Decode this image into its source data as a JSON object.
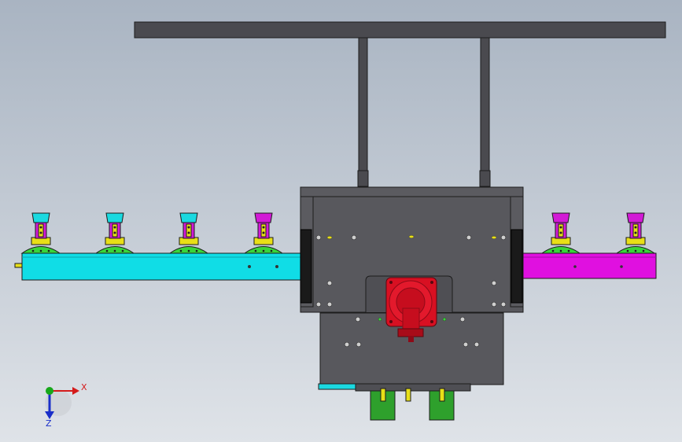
{
  "viewport": {
    "background_top": "#a9b4c2",
    "background_bottom": "#dfe3e8"
  },
  "colors": {
    "frame_dark": "#4a4a4f",
    "frame_mid": "#5b5b60",
    "plate": "#58585d",
    "edge": "#1c1c1c",
    "rail_left": "#10dde6",
    "rail_right": "#e010e0",
    "clamp_green": "#39d43a",
    "clamp_yellow": "#e8df17",
    "clamp_cyan": "#1ad9e0",
    "clamp_magenta": "#d21ad6",
    "motor_red": "#d81022",
    "motor_dark_red": "#8e0a17",
    "valve_green": "#2ea02c",
    "hole": "#cfcfcf",
    "axis_x": "#d41b1b",
    "axis_y": "#17a81a",
    "axis_z": "#1a2fc9"
  },
  "triad": {
    "x_label": "X",
    "z_label": "Z"
  }
}
